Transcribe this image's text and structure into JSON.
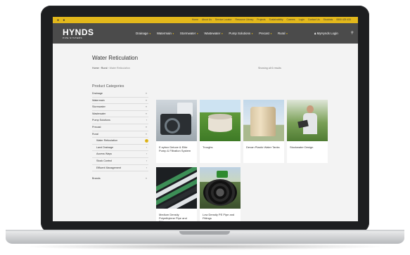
{
  "topbar": {
    "dots": "● ●",
    "links": [
      "Home",
      "About Us",
      "Service Locator",
      "Resource Library",
      "Projects",
      "Sustainability",
      "Careers",
      "Login",
      "Contact Us",
      "Stockists",
      "0800 425 433"
    ]
  },
  "header": {
    "logo_text": "HYNDS",
    "logo_sub": "PIPE SYSTEMS",
    "nav": [
      {
        "label": "Drainage"
      },
      {
        "label": "Watermain"
      },
      {
        "label": "Stormwater"
      },
      {
        "label": "Wastewater"
      },
      {
        "label": "Pump Solutions"
      },
      {
        "label": "Precast"
      },
      {
        "label": "Rural"
      }
    ],
    "login_label": "MyHynds Login",
    "search_icon": "search-icon"
  },
  "page": {
    "title": "Water Reticulation",
    "breadcrumb": {
      "home": "Home",
      "sep1": "›",
      "rural": "Rural",
      "sep2": "›",
      "current": "Water Reticulation"
    },
    "showing": "Showing all 6 results"
  },
  "sidebar": {
    "title": "Product Categories",
    "items": [
      {
        "label": "Drainage",
        "chev": "»"
      },
      {
        "label": "Watermain",
        "chev": "»"
      },
      {
        "label": "Stormwater",
        "chev": "»"
      },
      {
        "label": "Wastewater",
        "chev": "»"
      },
      {
        "label": "Pump Solutions",
        "chev": "›"
      },
      {
        "label": "Precast",
        "chev": "»"
      },
      {
        "label": "Rural",
        "chev": "»"
      },
      {
        "label": "Water Reticulation",
        "chev": "›"
      },
      {
        "label": "Land Drainage",
        "chev": "›"
      },
      {
        "label": "Access Ways",
        "chev": "›"
      },
      {
        "label": "Stock Control",
        "chev": "›"
      },
      {
        "label": "Effluent Management",
        "chev": "›"
      }
    ],
    "brands": {
      "label": "Brands",
      "chev": "»"
    }
  },
  "products": [
    {
      "name": "E.sybox Deluxe & Elite Pump & Filtration System"
    },
    {
      "name": "Troughs"
    },
    {
      "name": "Devan Plastic Water Tanks"
    },
    {
      "name": "Stockwater Design"
    },
    {
      "name": "Medium Density Polyethylene Pipe and Fittings"
    },
    {
      "name": "Low Density PE Pipe and Fittings"
    }
  ],
  "colors": {
    "accent": "#e3b81b",
    "header_bg": "#4b4b4b",
    "page_bg": "#f3f3f3"
  }
}
